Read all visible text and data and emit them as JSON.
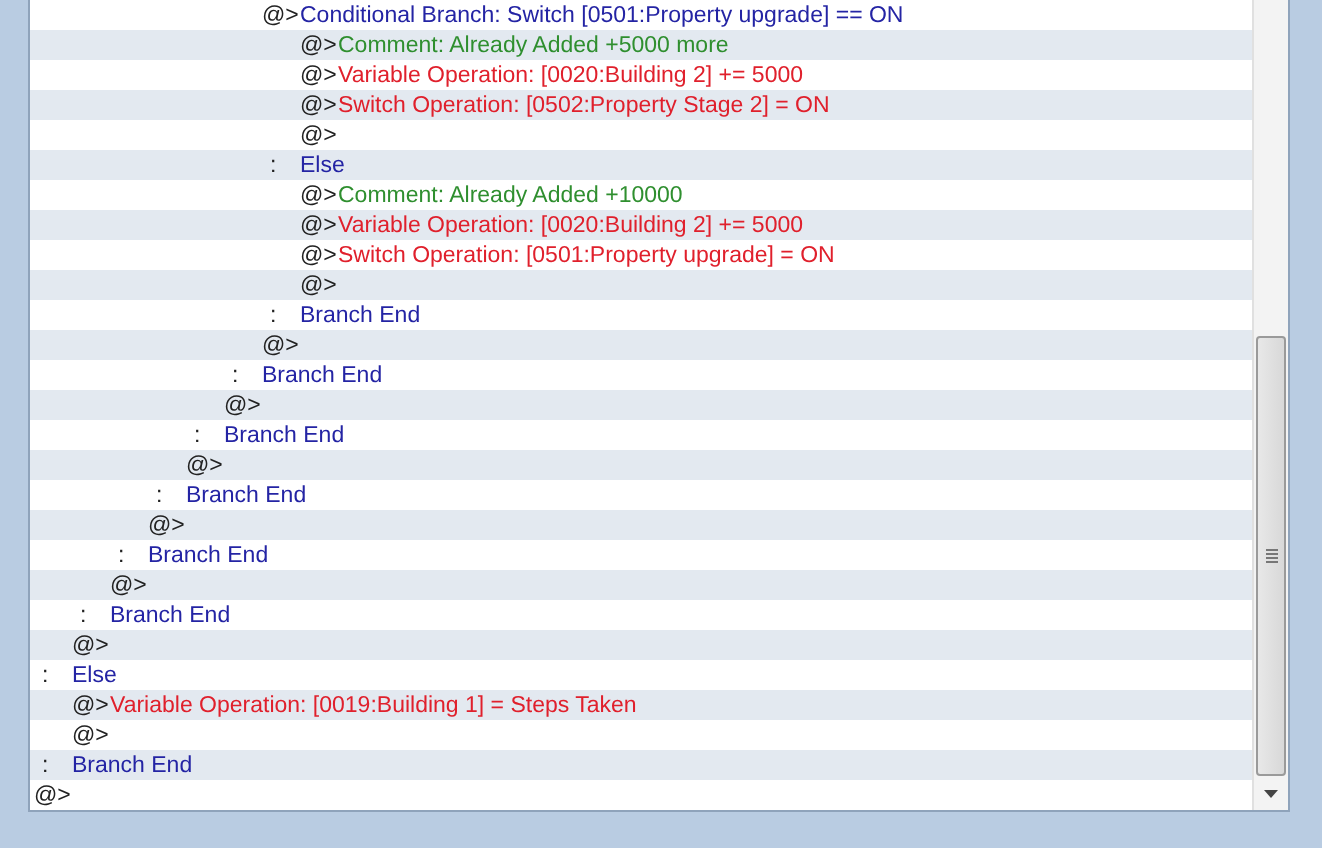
{
  "event_commands": [
    {
      "children": [
        {
          "children": [
            {
              "children": [
                {
                  "children": [
                    {
                      "children": [
                        {
                          "children": [
                            {
                              "marker": "@>",
                              "kind": "branch",
                              "text": "Conditional Branch: Switch [0501:Property upgrade] == ON",
                              "children": [
                                {
                                  "marker": "@>",
                                  "kind": "comment",
                                  "text": "Comment: Already Added +5000 more"
                                },
                                {
                                  "marker": "@>",
                                  "kind": "operation",
                                  "text": "Variable Operation: [0020:Building 2] += 5000"
                                },
                                {
                                  "marker": "@>",
                                  "kind": "operation",
                                  "text": "Switch Operation: [0502:Property Stage 2] = ON"
                                },
                                {
                                  "marker": "@>"
                                }
                              ]
                            },
                            {
                              "marker": ":",
                              "kind": "branch",
                              "text": "Else",
                              "children": [
                                {
                                  "marker": "@>",
                                  "kind": "comment",
                                  "text": "Comment: Already Added +10000"
                                },
                                {
                                  "marker": "@>",
                                  "kind": "operation",
                                  "text": "Variable Operation: [0020:Building 2] += 5000"
                                },
                                {
                                  "marker": "@>",
                                  "kind": "operation",
                                  "text": "Switch Operation: [0501:Property upgrade] = ON"
                                },
                                {
                                  "marker": "@>"
                                }
                              ]
                            },
                            {
                              "marker": ":",
                              "kind": "branch",
                              "text": "Branch End"
                            },
                            {
                              "marker": "@>"
                            }
                          ]
                        },
                        {
                          "marker": ":",
                          "kind": "branch",
                          "text": "Branch End"
                        },
                        {
                          "marker": "@>"
                        }
                      ]
                    },
                    {
                      "marker": ":",
                      "kind": "branch",
                      "text": "Branch End"
                    },
                    {
                      "marker": "@>"
                    }
                  ]
                },
                {
                  "marker": ":",
                  "kind": "branch",
                  "text": "Branch End"
                },
                {
                  "marker": "@>"
                }
              ]
            },
            {
              "marker": ":",
              "kind": "branch",
              "text": "Branch End"
            },
            {
              "marker": "@>"
            }
          ]
        },
        {
          "marker": ":",
          "kind": "branch",
          "text": "Branch End"
        },
        {
          "marker": "@>"
        }
      ]
    },
    {
      "marker": ":",
      "kind": "branch",
      "text": "Else",
      "children": [
        {
          "marker": "@>",
          "kind": "operation",
          "text": "Variable Operation: [0019:Building 1] = Steps Taken"
        },
        {
          "marker": "@>"
        }
      ]
    },
    {
      "marker": ":",
      "kind": "branch",
      "text": "Branch End"
    },
    {
      "marker": "@>"
    }
  ]
}
